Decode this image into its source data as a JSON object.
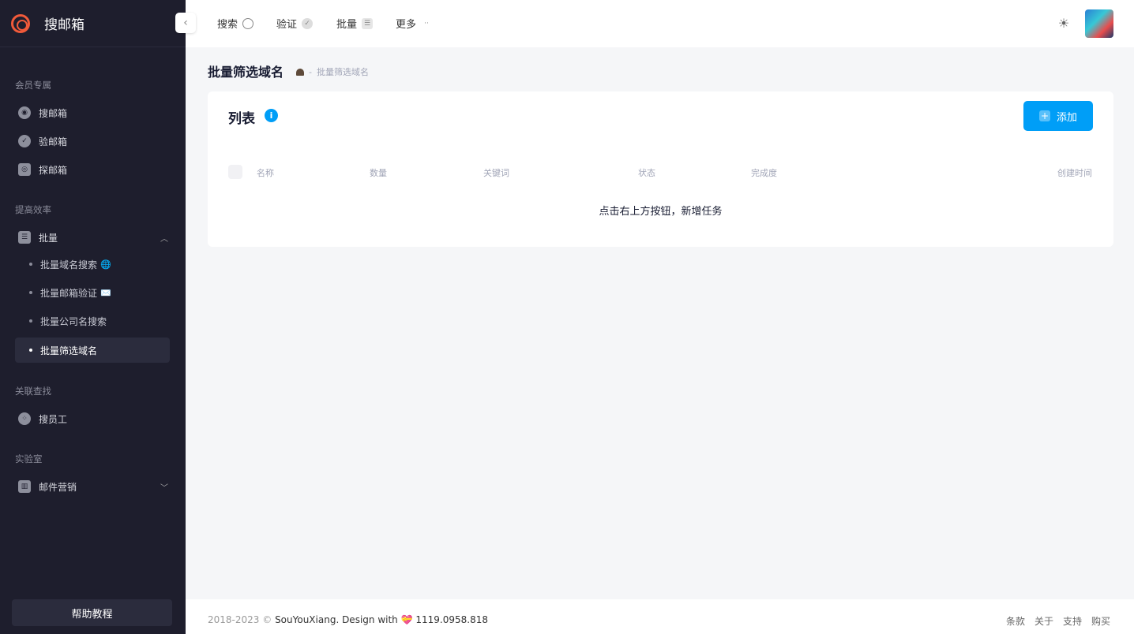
{
  "brand": {
    "name": "搜邮箱"
  },
  "sidebar": {
    "sections": [
      {
        "label": "会员专属"
      },
      {
        "label": "提高效率"
      },
      {
        "label": "关联查找"
      },
      {
        "label": "实验室"
      }
    ],
    "items": [
      {
        "label": "搜邮箱",
        "icon": "search-mail-icon"
      },
      {
        "label": "验邮箱",
        "icon": "check-circle-icon"
      },
      {
        "label": "探邮箱",
        "icon": "scan-icon"
      },
      {
        "label": "批量",
        "icon": "checklist-icon"
      },
      {
        "label": "搜员工",
        "icon": "people-icon"
      },
      {
        "label": "邮件营销",
        "icon": "chart-icon"
      }
    ],
    "sub_items": [
      {
        "label": "批量域名搜索",
        "emoji": "🌐"
      },
      {
        "label": "批量邮箱验证",
        "emoji": "✉️"
      },
      {
        "label": "批量公司名搜索",
        "emoji": ""
      },
      {
        "label": "批量筛选域名",
        "emoji": ""
      }
    ],
    "help_label": "帮助教程"
  },
  "topbar": {
    "tabs": [
      {
        "label": "搜索"
      },
      {
        "label": "验证"
      },
      {
        "label": "批量"
      },
      {
        "label": "更多"
      }
    ]
  },
  "page": {
    "title": "批量筛选域名",
    "breadcrumb_sep": "-",
    "breadcrumb_current": "批量筛选域名"
  },
  "card": {
    "title": "列表",
    "add_label": "添加",
    "columns": [
      "名称",
      "数量",
      "关键词",
      "状态",
      "完成度",
      "创建时间"
    ],
    "empty_message": "点击右上方按钮，新增任务"
  },
  "footer": {
    "copyright_prefix": "2018-2023 ©",
    "copyright_brand": "SouYouXiang. Design with",
    "heart": "💝",
    "version": "1119.0958.818",
    "links": [
      "条款",
      "关于",
      "支持",
      "购买"
    ]
  },
  "colors": {
    "sidebar_bg": "#1e1e2d",
    "primary": "#009ef7",
    "brand": "#f15a3a"
  }
}
